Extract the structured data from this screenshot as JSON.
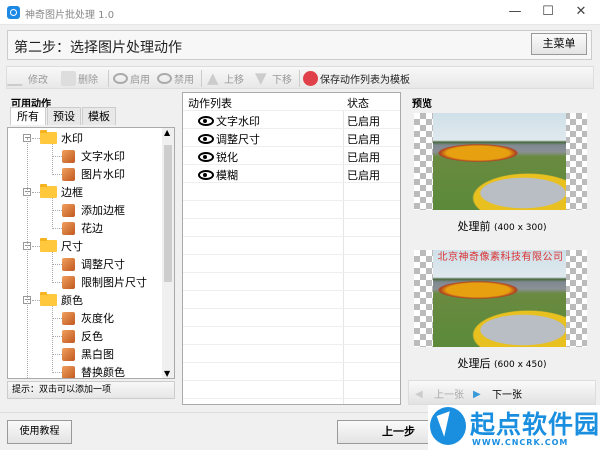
{
  "window": {
    "title": "神奇图片批处理 1.0",
    "minimize": "—",
    "maximize": "☐",
    "close": "✕"
  },
  "header": {
    "step": "第二步：选择图片处理动作",
    "main_menu": "主菜单"
  },
  "toolbar": {
    "edit": "修改",
    "delete": "删除",
    "enable": "启用",
    "disable": "禁用",
    "move_up": "上移",
    "move_down": "下移",
    "save_template": "保存动作列表为模板"
  },
  "left": {
    "title": "可用动作",
    "tabs": [
      "所有",
      "预设",
      "模板"
    ],
    "tree": [
      {
        "label": "水印",
        "children": [
          "文字水印",
          "图片水印"
        ]
      },
      {
        "label": "边框",
        "children": [
          "添加边框",
          "花边"
        ]
      },
      {
        "label": "尺寸",
        "children": [
          "调整尺寸",
          "限制图片尺寸"
        ]
      },
      {
        "label": "颜色",
        "children": [
          "灰度化",
          "反色",
          "黑白图",
          "替换颜色"
        ]
      }
    ],
    "hint": "提示：双击可以添加一项"
  },
  "actions": {
    "col_name": "动作列表",
    "col_status": "状态",
    "rows": [
      {
        "name": "文字水印",
        "status": "已启用"
      },
      {
        "name": "调整尺寸",
        "status": "已启用"
      },
      {
        "name": "锐化",
        "status": "已启用"
      },
      {
        "name": "模糊",
        "status": "已启用"
      }
    ]
  },
  "preview": {
    "title": "预览",
    "before_label": "处理前",
    "before_size": "(400 x 300)",
    "watermark_text": "北京神奇像素科技有限公司",
    "after_label": "处理后",
    "after_size": "(600 x 450)",
    "prev": "上一张",
    "next": "下一张"
  },
  "bottom": {
    "tutorial": "使用教程",
    "prev_step": "上一步"
  },
  "logo": {
    "name": "起点软件园",
    "url": "WWW.CNCRK.COM"
  },
  "colors": {
    "accent": "#1a8fe0",
    "save_icon": "#e0404a",
    "watermark": "#dd3333"
  }
}
